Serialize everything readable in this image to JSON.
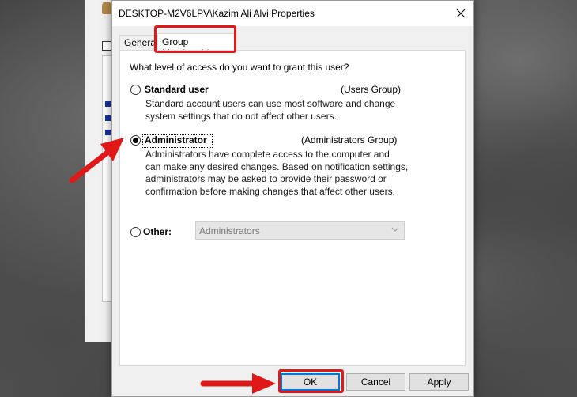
{
  "window": {
    "title": "DESKTOP-M2V6LPV\\Kazim Ali Alvi Properties"
  },
  "tabs": [
    {
      "label": "General",
      "active": false
    },
    {
      "label": "Group Membership",
      "active": true
    }
  ],
  "question": "What level of access do you want to grant this user?",
  "options": {
    "standard": {
      "label": "Standard user",
      "group": "(Users Group)",
      "description_lines": [
        "Standard account users can use most software and change",
        "system settings that do not affect other users."
      ],
      "selected": false
    },
    "administrator": {
      "label": "Administrator",
      "group": "(Administrators Group)",
      "description_lines": [
        "Administrators have complete access to the computer and",
        "can make any desired changes. Based on notification settings,",
        "administrators may be asked to provide their password or",
        "confirmation before making changes that affect other users."
      ],
      "selected": true
    },
    "other": {
      "label": "Other:",
      "select_value": "Administrators",
      "selected": false,
      "enabled": false
    }
  },
  "buttons": {
    "ok": "OK",
    "cancel": "Cancel",
    "apply": "Apply"
  },
  "colors": {
    "highlight": "#e01818",
    "accent": "#0078d7"
  }
}
